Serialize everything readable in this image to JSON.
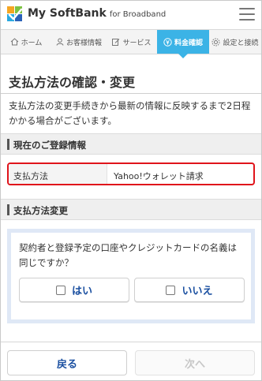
{
  "header": {
    "brand": "My SoftBank",
    "brand_sub": "for Broadband",
    "menu_icon": "hamburger-menu-icon"
  },
  "nav": {
    "items": [
      {
        "label": "ホーム",
        "icon": "home-icon"
      },
      {
        "label": "お客様情報",
        "icon": "user-icon"
      },
      {
        "label": "サービス",
        "icon": "edit-icon"
      },
      {
        "label": "料金確認",
        "icon": "yen-icon"
      },
      {
        "label": "設定と接続",
        "icon": "gear-icon"
      }
    ],
    "active": "料金確認"
  },
  "page": {
    "title": "支払方法の確認・変更",
    "lead": "支払方法の変更手続きから最新の情報に反映するまで2日程かかる場合がございます。"
  },
  "current": {
    "heading": "現在のご登録情報",
    "label": "支払方法",
    "value": "Yahoo!ウォレット請求"
  },
  "change": {
    "heading": "支払方法変更",
    "question": "契約者と登録予定の口座やクレジットカードの名義は同じですか？",
    "yes": "はい",
    "no": "いいえ"
  },
  "footer": {
    "back": "戻る",
    "next": "次へ"
  },
  "colors": {
    "accent": "#3bb3e6",
    "highlight_border": "#e0141b",
    "link": "#1a4fa0"
  }
}
